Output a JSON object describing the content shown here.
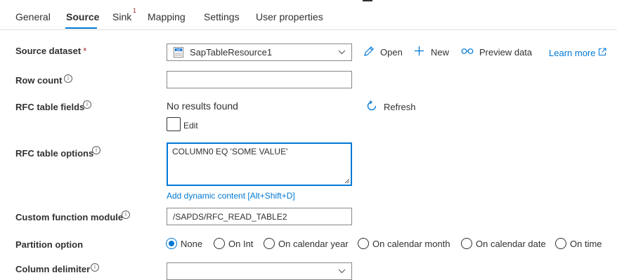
{
  "tabs": [
    {
      "label": "General"
    },
    {
      "label": "Source"
    },
    {
      "label": "Sink",
      "badge": "1"
    },
    {
      "label": "Mapping"
    },
    {
      "label": "Settings"
    },
    {
      "label": "User properties"
    }
  ],
  "source_dataset": {
    "label": "Source dataset",
    "required_mark": "*",
    "value": "SapTableResource1",
    "icon_text": "SAP TABLE",
    "open_label": "Open",
    "new_label": "New",
    "preview_label": "Preview data",
    "learn_more_label": "Learn more"
  },
  "row_count": {
    "label": "Row count",
    "value": ""
  },
  "rfc_table_fields": {
    "label": "RFC table fields",
    "status": "No results found",
    "refresh_label": "Refresh",
    "edit_label": "Edit",
    "edit_checked": false
  },
  "rfc_table_options": {
    "label": "RFC table options",
    "value": "COLUMN0 EQ 'SOME VALUE'",
    "dynamic_content_label": "Add dynamic content [Alt+Shift+D]"
  },
  "custom_function_module": {
    "label": "Custom function module",
    "value": "/SAPDS/RFC_READ_TABLE2"
  },
  "partition_option": {
    "label": "Partition option",
    "selected": "None",
    "options": [
      "None",
      "On Int",
      "On calendar year",
      "On calendar month",
      "On calendar date",
      "On time"
    ]
  },
  "column_delimiter": {
    "label": "Column delimiter"
  },
  "colors": {
    "accent": "#0078d4",
    "required": "#a4262c",
    "text": "#323130",
    "border": "#8a8886"
  }
}
